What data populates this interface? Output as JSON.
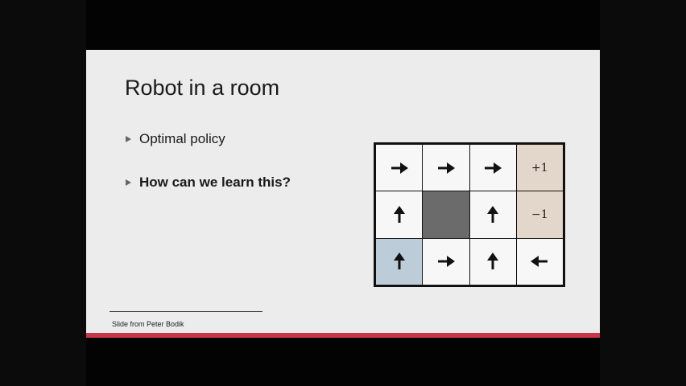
{
  "slide": {
    "title": "Robot in a room",
    "bullets": [
      {
        "text": "Optimal policy",
        "bold": false
      },
      {
        "text": "How can we learn this?",
        "bold": true
      }
    ],
    "footnote": "Slide from Peter Bodik"
  },
  "gridworld": {
    "rows": 3,
    "cols": 4,
    "cells": [
      [
        {
          "kind": "arrow",
          "dir": "right",
          "icon": "arrow-right-icon"
        },
        {
          "kind": "arrow",
          "dir": "right",
          "icon": "arrow-right-icon"
        },
        {
          "kind": "arrow",
          "dir": "right",
          "icon": "arrow-right-icon"
        },
        {
          "kind": "reward",
          "text": "+1"
        }
      ],
      [
        {
          "kind": "arrow",
          "dir": "up",
          "icon": "arrow-up-icon"
        },
        {
          "kind": "wall"
        },
        {
          "kind": "arrow",
          "dir": "up",
          "icon": "arrow-up-icon"
        },
        {
          "kind": "reward",
          "text": "−1"
        }
      ],
      [
        {
          "kind": "arrow",
          "dir": "up",
          "icon": "arrow-up-icon",
          "start": true
        },
        {
          "kind": "arrow",
          "dir": "right",
          "icon": "arrow-right-icon"
        },
        {
          "kind": "arrow",
          "dir": "up",
          "icon": "arrow-up-icon"
        },
        {
          "kind": "arrow",
          "dir": "left",
          "icon": "arrow-left-icon"
        }
      ]
    ]
  },
  "colors": {
    "slide_background": "#ececec",
    "accent_bar": "#c8364a",
    "wall_cell": "#6b6b6b",
    "terminal_cell": "#e3d6cb",
    "start_cell": "#bccdd9",
    "empty_cell": "#f7f7f7"
  }
}
